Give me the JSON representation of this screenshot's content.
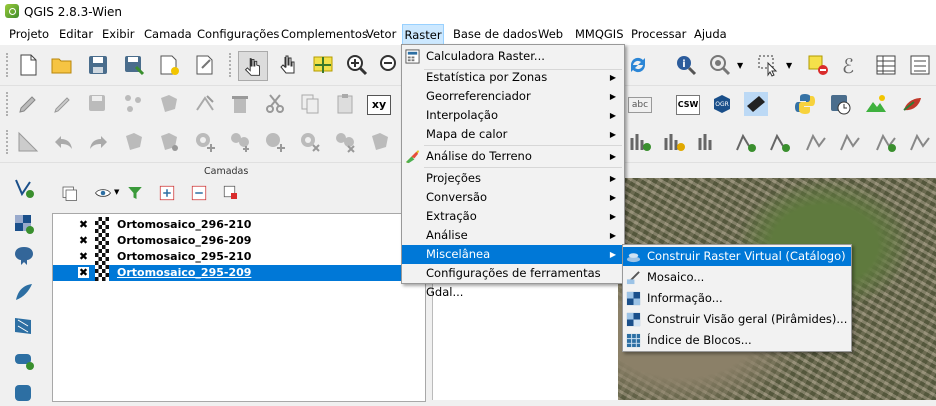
{
  "app": {
    "title": "QGIS 2.8.3-Wien"
  },
  "menubar": [
    "Projeto",
    "Editar",
    "Exibir",
    "Camada",
    "Configurações",
    "Complementos",
    "Vetor",
    "Raster",
    "Base de dados",
    "Web",
    "MMQGIS",
    "Processar",
    "Ajuda"
  ],
  "raster_menu": {
    "items": [
      {
        "label": "Calculadora Raster...",
        "submenu": false
      },
      {
        "label": "Estatística por Zonas",
        "submenu": true
      },
      {
        "label": "Georreferenciador",
        "submenu": true
      },
      {
        "label": "Interpolação",
        "submenu": true
      },
      {
        "label": "Mapa de calor",
        "submenu": true
      },
      {
        "label": "Análise do Terreno",
        "submenu": true
      },
      {
        "label": "Projeções",
        "submenu": true
      },
      {
        "label": "Conversão",
        "submenu": true
      },
      {
        "label": "Extração",
        "submenu": true
      },
      {
        "label": "Análise",
        "submenu": true
      },
      {
        "label": "Miscelânea",
        "submenu": true
      },
      {
        "label": "Configurações de ferramentas Gdal...",
        "submenu": false
      }
    ]
  },
  "misc_submenu": {
    "items": [
      "Construir Raster Virtual (Catálogo) ...",
      "Mosaico...",
      "Informação...",
      "Construir Visão geral (Pirâmides)...",
      "Índice de Blocos..."
    ]
  },
  "layers_panel": {
    "title": "Camadas",
    "layers": [
      {
        "name": "Ortomosaico_296-210",
        "checked": true,
        "selected": false
      },
      {
        "name": "Ortomosaico_296-209",
        "checked": true,
        "selected": false
      },
      {
        "name": "Ortomosaico_295-210",
        "checked": true,
        "selected": false
      },
      {
        "name": "Ortomosaico_295-209",
        "checked": true,
        "selected": true
      }
    ]
  },
  "toolbar_icons": {
    "text_xy": "xy",
    "text_abc": "abc",
    "text_csw": "CSW",
    "text_epsilon": "ℰ"
  },
  "colors": {
    "highlight": "#0078d7",
    "menu_active": "#cce8ff"
  }
}
